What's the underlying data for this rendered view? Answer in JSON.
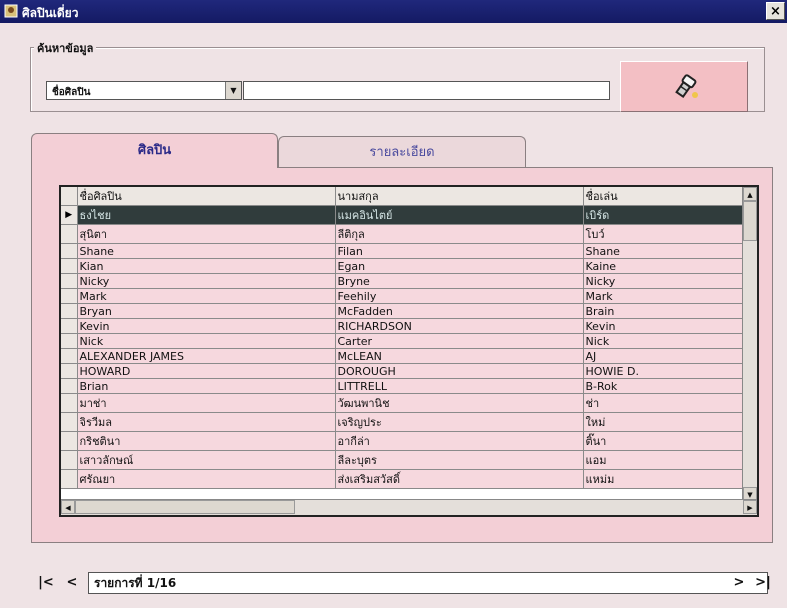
{
  "window": {
    "title": "ศิลปินเดี่ยว",
    "close_label": "×"
  },
  "search": {
    "group_label": "ค้นหาข้อมูล",
    "field_selected": "ชื่อศิลปิน",
    "input_value": "",
    "button_icon": "flashlight-icon"
  },
  "tabs": [
    {
      "label": "ศิลปิน",
      "active": true
    },
    {
      "label": "รายละเอียด",
      "active": false
    }
  ],
  "grid": {
    "columns": [
      "ชื่อศิลปิน",
      "นามสกุล",
      "ชื่อเล่น"
    ],
    "rows": [
      [
        "ธงไชย",
        "แมคอินไตย์",
        "เบิร์ด"
      ],
      [
        "สุนิตา",
        "ลีติกุล",
        "โบว์"
      ],
      [
        "Shane",
        "Filan",
        "Shane"
      ],
      [
        "Kian",
        "Egan",
        "Kaine"
      ],
      [
        "Nicky",
        "Bryne",
        "Nicky"
      ],
      [
        "Mark",
        "Feehily",
        "Mark"
      ],
      [
        "Bryan",
        "McFadden",
        "Brain"
      ],
      [
        "Kevin",
        "RICHARDSON",
        "Kevin"
      ],
      [
        "Nick",
        "Carter",
        "Nick"
      ],
      [
        "ALEXANDER JAMES",
        "McLEAN",
        "AJ"
      ],
      [
        "HOWARD",
        "DOROUGH",
        "HOWIE D."
      ],
      [
        "Brian",
        "LITTRELL",
        "B-Rok"
      ],
      [
        "มาช่า",
        "วัฒนพานิช",
        "ช่า"
      ],
      [
        "จิรวีมล",
        "เจริญประ",
        "ใหม่"
      ],
      [
        "กริชตินา",
        "อากีล่า",
        "ติ๊นา"
      ],
      [
        "เสาวลักษณ์",
        "ลีละบุตร",
        "แอม"
      ],
      [
        "ศรัณยา",
        "ส่งเสริมสวัสดิ์",
        "แหม่ม"
      ]
    ],
    "selected_row": 0
  },
  "navigation": {
    "first_label": "|<",
    "prev_label": "<",
    "record_text": "รายการที่ 1/16",
    "next_label": ">",
    "last_label": ">|"
  }
}
